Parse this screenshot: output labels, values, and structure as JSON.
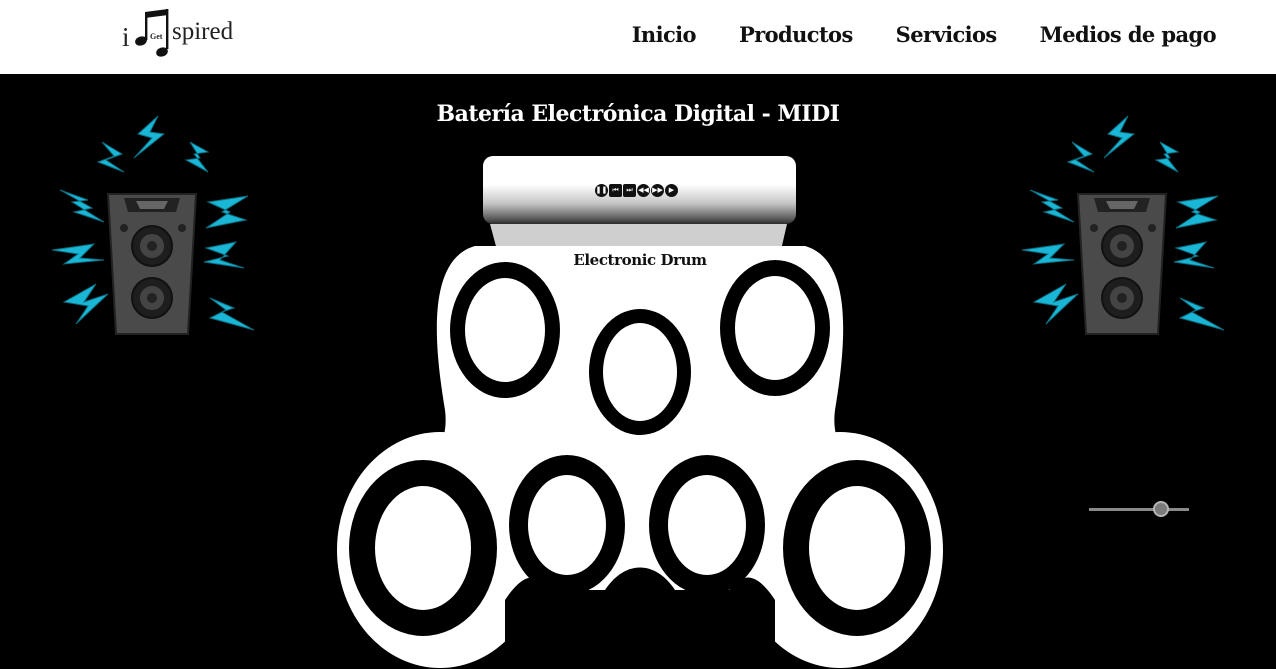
{
  "brand": {
    "logo_i": "i",
    "logo_get": "Get",
    "logo_spired": "spired"
  },
  "nav": {
    "items": [
      {
        "label": "Inicio"
      },
      {
        "label": "Productos"
      },
      {
        "label": "Servicios"
      },
      {
        "label": "Medios de pago"
      }
    ]
  },
  "page": {
    "title": "Batería Electrónica Digital - MIDI"
  },
  "drum_kit": {
    "label": "Electronic Drum",
    "controls": [
      {
        "icon": "pause-icon",
        "glyph": "❚❚"
      },
      {
        "icon": "skip-back-icon",
        "glyph": "⏮"
      },
      {
        "icon": "skip-forward-icon",
        "glyph": "⏭"
      },
      {
        "icon": "rewind-icon",
        "glyph": "◀◀"
      },
      {
        "icon": "fast-forward-icon",
        "glyph": "▶▶"
      },
      {
        "icon": "play-icon",
        "glyph": "▶"
      }
    ],
    "pad_count": 7
  },
  "volume_slider": {
    "value_fraction": 0.7
  },
  "colors": {
    "background": "#000000",
    "nav_bg": "#ffffff",
    "bolt_accent": "#1ab6d6",
    "speaker_body": "#4a4a4a"
  }
}
